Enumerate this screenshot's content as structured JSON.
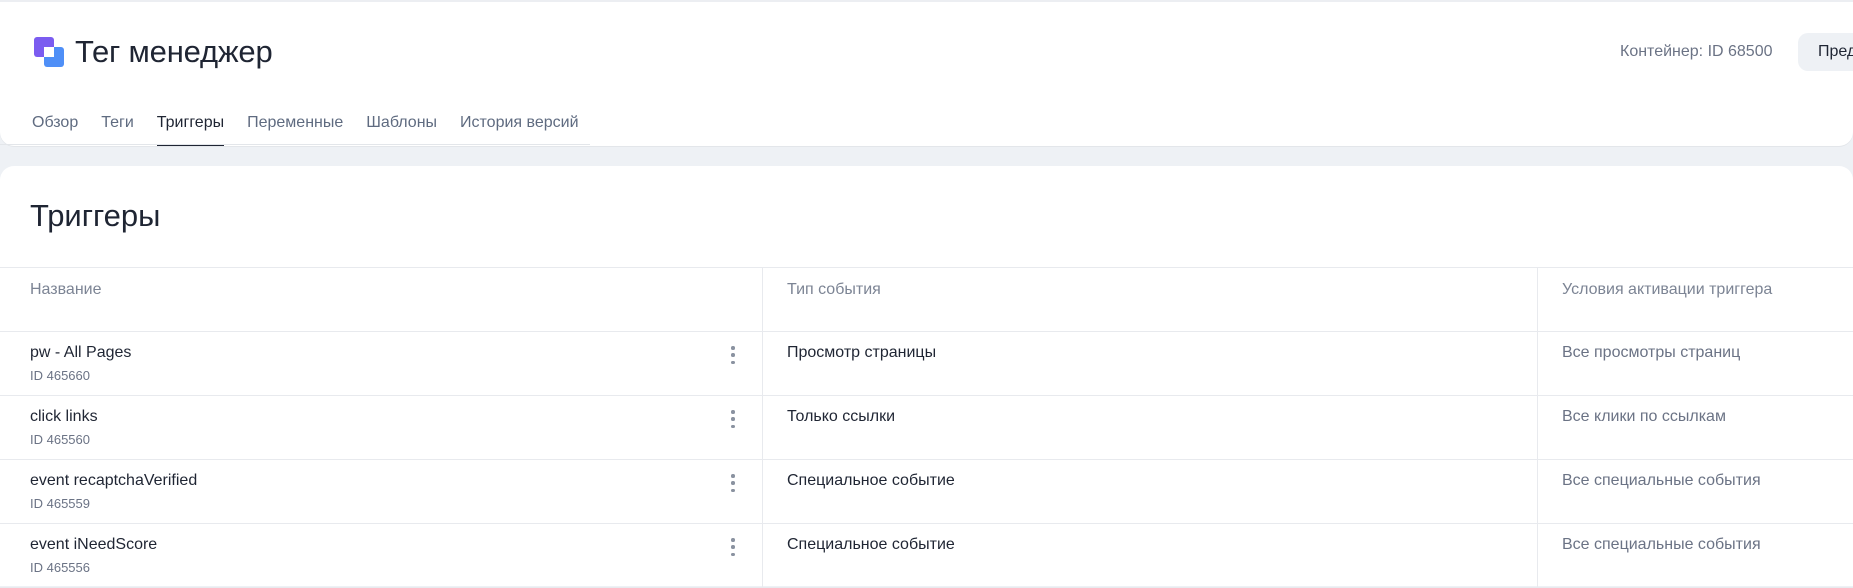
{
  "header": {
    "app_title": "Тег менеджер",
    "container_label": "Контейнер: ID 68500",
    "preview_button": "Предпросмотр",
    "logo_colors": [
      "#7b5cf0",
      "#4f8ff7"
    ]
  },
  "tabs": [
    {
      "label": "Обзор",
      "active": false
    },
    {
      "label": "Теги",
      "active": false
    },
    {
      "label": "Триггеры",
      "active": true
    },
    {
      "label": "Переменные",
      "active": false
    },
    {
      "label": "Шаблоны",
      "active": false
    },
    {
      "label": "История версий",
      "active": false
    }
  ],
  "main": {
    "title": "Триггеры",
    "columns": [
      "Название",
      "Тип события",
      "Условия активации триггера"
    ],
    "rows": [
      {
        "name": "pw - All Pages",
        "id": "ID 465660",
        "event_type": "Просмотр страницы",
        "condition": "Все просмотры страниц",
        "menu_icon": "more-vertical-icon"
      },
      {
        "name": "click links",
        "id": "ID 465560",
        "event_type": "Только ссылки",
        "condition": "Все клики по ссылкам",
        "menu_icon": "more-vertical-icon"
      },
      {
        "name": "event recaptchaVerified",
        "id": "ID 465559",
        "event_type": "Специальное событие",
        "condition": "Все специальные события",
        "menu_icon": "more-vertical-icon"
      },
      {
        "name": "event iNeedScore",
        "id": "ID 465556",
        "event_type": "Специальное событие",
        "condition": "Все специальные события",
        "menu_icon": "more-vertical-icon"
      }
    ]
  },
  "colors": {
    "background": "#eef1f5",
    "surface": "#ffffff",
    "text_primary": "#1f2533",
    "text_secondary": "#6b7385",
    "divider": "#e8eaee"
  }
}
